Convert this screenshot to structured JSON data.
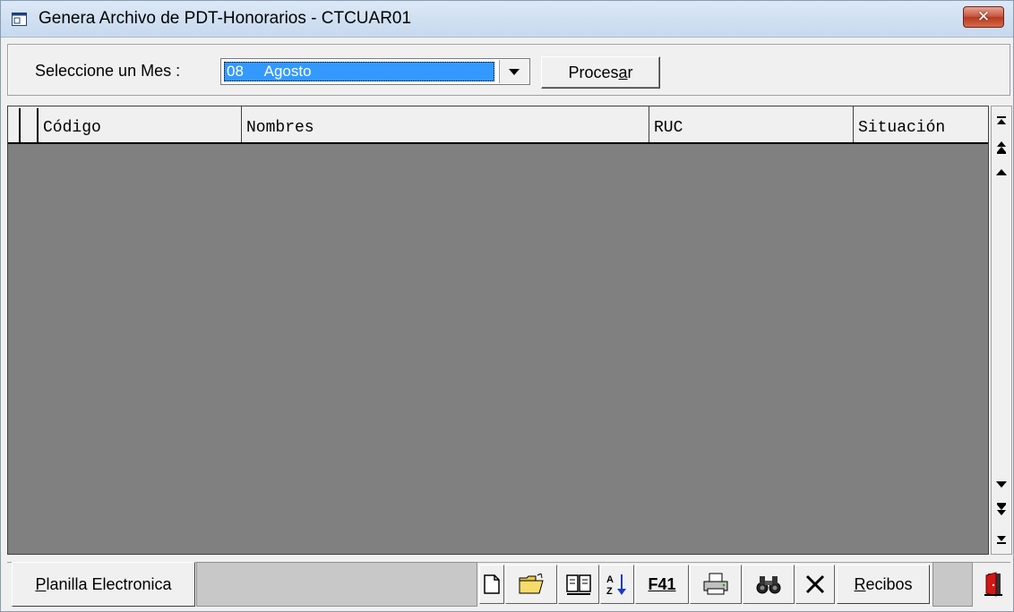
{
  "window": {
    "title": "Genera Archivo de PDT-Honorarios - CTCUAR01",
    "close_label": "✕"
  },
  "filter": {
    "month_label": "Seleccione un Mes :",
    "month_code": "08",
    "month_name": "Agosto",
    "process_label": "Procesar",
    "process_accel": "a"
  },
  "grid": {
    "columns": [
      "Código",
      "Nombres",
      "RUC",
      "Situación"
    ],
    "rows": []
  },
  "bottom": {
    "planilla_label": "Planilla Electronica",
    "planilla_accel": "P",
    "f41_label": "F41",
    "recibos_label": "Recibos",
    "recibos_accel": "R"
  },
  "icons": {
    "app": "app-window-icon",
    "new": "new-document-icon",
    "open": "open-folder-icon",
    "book": "book-icon",
    "sort": "sort-az-icon",
    "print": "printer-icon",
    "find": "binoculars-icon",
    "delete": "delete-x-icon",
    "exit": "exit-door-icon"
  },
  "colors": {
    "selection": "#3399ff",
    "grid_background": "#808080",
    "close_button": "#c7543e"
  }
}
